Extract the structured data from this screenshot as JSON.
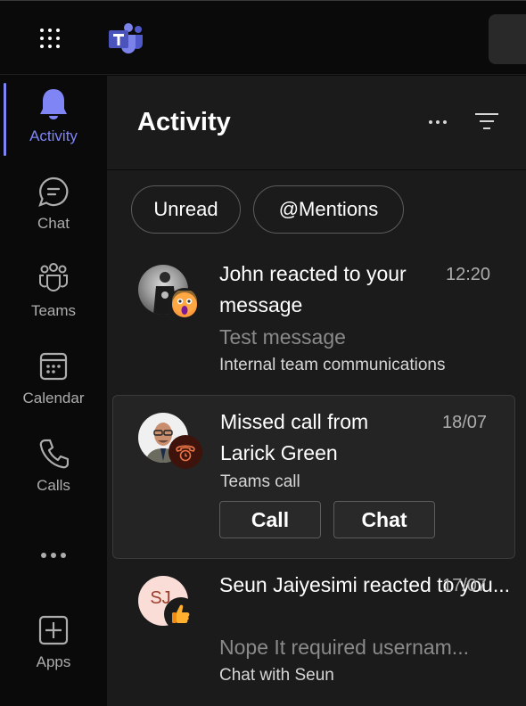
{
  "app": {
    "name": "Microsoft Teams",
    "accent": "#7f85f5"
  },
  "rail": {
    "items": [
      {
        "id": "activity",
        "label": "Activity",
        "icon": "bell-icon",
        "active": true
      },
      {
        "id": "chat",
        "label": "Chat",
        "icon": "chat-icon"
      },
      {
        "id": "teams",
        "label": "Teams",
        "icon": "teams-icon"
      },
      {
        "id": "calendar",
        "label": "Calendar",
        "icon": "calendar-icon"
      },
      {
        "id": "calls",
        "label": "Calls",
        "icon": "phone-icon"
      },
      {
        "id": "more",
        "label": "",
        "icon": "more-horizontal-icon"
      },
      {
        "id": "apps",
        "label": "Apps",
        "icon": "add-app-icon"
      }
    ]
  },
  "pane": {
    "title": "Activity",
    "filters": [
      "Unread",
      "@Mentions"
    ]
  },
  "feed": [
    {
      "title": "John reacted to your message",
      "time": "12:20",
      "preview": "Test message",
      "context": "Internal team communications",
      "reaction": "surprised-emoji",
      "reaction_glyph": "😮"
    },
    {
      "title": "Missed call from Larick Green",
      "time": "18/07",
      "context": "Teams call",
      "reaction": "missed-call-icon",
      "actions": [
        "Call",
        "Chat"
      ]
    },
    {
      "title": "Seun Jaiyesimi reacted to you...",
      "time": "17/07",
      "preview": "Nope It required usernam...",
      "context": "Chat with Seun",
      "initials": "SJ",
      "reaction": "thumbs-up-emoji",
      "reaction_glyph": "👍"
    }
  ]
}
